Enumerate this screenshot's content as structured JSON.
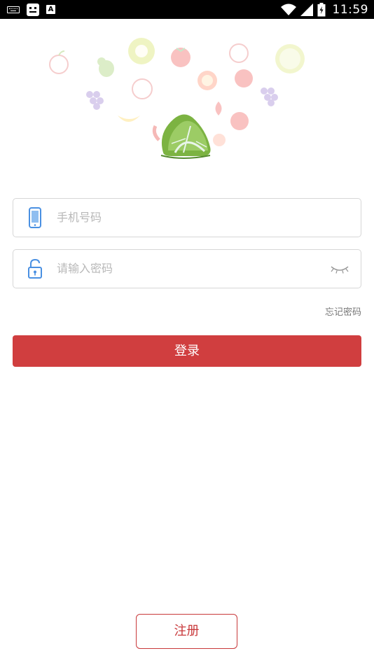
{
  "status_bar": {
    "time": "11:59",
    "icons": [
      "keyboard-icon",
      "robot-icon",
      "a-icon",
      "wifi-icon",
      "signal-icon",
      "battery-icon"
    ]
  },
  "login": {
    "phone_placeholder": "手机号码",
    "password_placeholder": "请输入密码",
    "forgot_label": "忘记密码",
    "login_label": "登录",
    "register_label": "注册"
  },
  "colors": {
    "accent": "#d03e3f",
    "icon_blue": "#4a90e2",
    "placeholder": "#b8b8b8"
  }
}
